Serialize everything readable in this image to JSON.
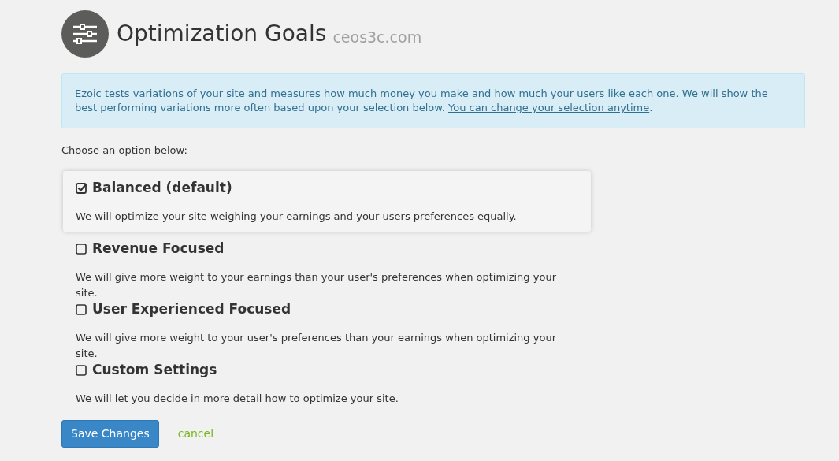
{
  "header": {
    "title": "Optimization Goals",
    "site": "ceos3c.com"
  },
  "notice": {
    "text": "Ezoic tests variations of your site and measures how much money you make and how much your users like each one. We will show the best performing variations more often based upon your selection below.",
    "link": "You can change your selection anytime",
    "end": "."
  },
  "prompt": "Choose an option below:",
  "options": [
    {
      "label": "Balanced (default)",
      "description": "We will optimize your site weighing your earnings and your users preferences equally.",
      "selected": true
    },
    {
      "label": "Revenue Focused",
      "description": "We will give more weight to your earnings than your user's preferences when optimizing your site.",
      "selected": false
    },
    {
      "label": "User Experienced Focused",
      "description": "We will give more weight to your user's preferences than your earnings when optimizing your site.",
      "selected": false
    },
    {
      "label": "Custom Settings",
      "description": "We will let you decide in more detail how to optimize your site.",
      "selected": false
    }
  ],
  "buttons": {
    "save": "Save Changes",
    "cancel": "cancel"
  }
}
